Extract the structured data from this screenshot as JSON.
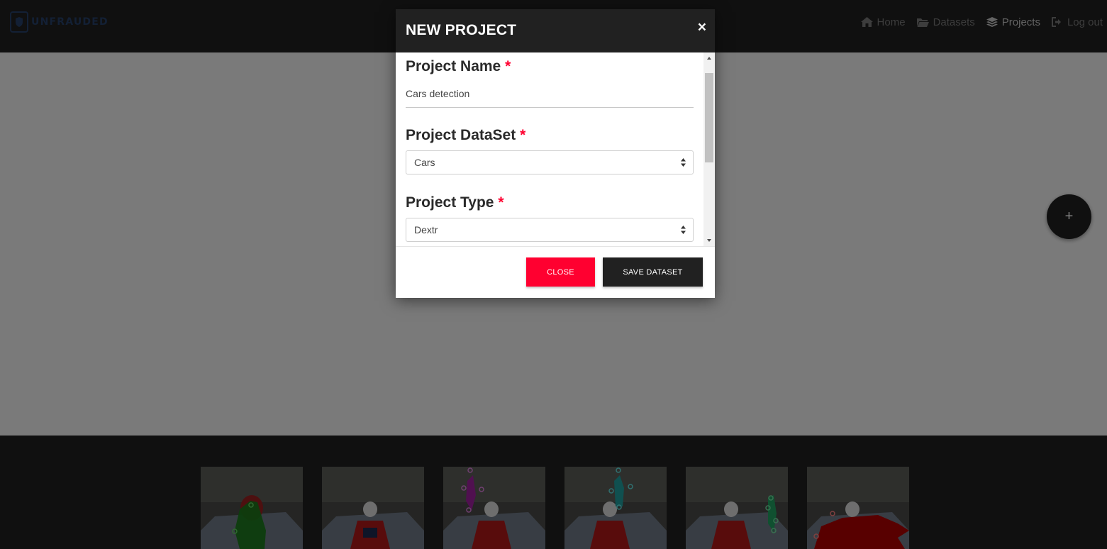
{
  "brand": {
    "name": "UNFRAUDED"
  },
  "nav": {
    "items": [
      {
        "label": "Home",
        "icon": "home-icon",
        "active": false
      },
      {
        "label": "Datasets",
        "icon": "folder-icon",
        "active": false
      },
      {
        "label": "Projects",
        "icon": "layers-icon",
        "active": true
      },
      {
        "label": "Log out",
        "icon": "logout-icon",
        "active": false
      }
    ]
  },
  "fab": {
    "label": "+"
  },
  "modal": {
    "title": "NEW PROJECT",
    "close_icon": "×",
    "fields": {
      "name": {
        "label": "Project Name",
        "required_mark": "*",
        "value": "Cars detection"
      },
      "dataset": {
        "label": "Project DataSet",
        "required_mark": "*",
        "value": "Cars"
      },
      "type": {
        "label": "Project Type",
        "required_mark": "*",
        "value": "Dextr"
      }
    },
    "buttons": {
      "close": "CLOSE",
      "save": "SAVE DATASET"
    }
  },
  "thumbnails": [
    {
      "overlay": "green mask",
      "color": "#1a7a1a"
    },
    {
      "overlay": "none",
      "color": ""
    },
    {
      "overlay": "magenta mask",
      "color": "#a020a0"
    },
    {
      "overlay": "teal mask",
      "color": "#20a0a0"
    },
    {
      "overlay": "green mask",
      "color": "#20a060"
    },
    {
      "overlay": "red mask",
      "color": "#b00000"
    }
  ],
  "colors": {
    "accent_red": "#ff0030",
    "dark": "#212121"
  }
}
